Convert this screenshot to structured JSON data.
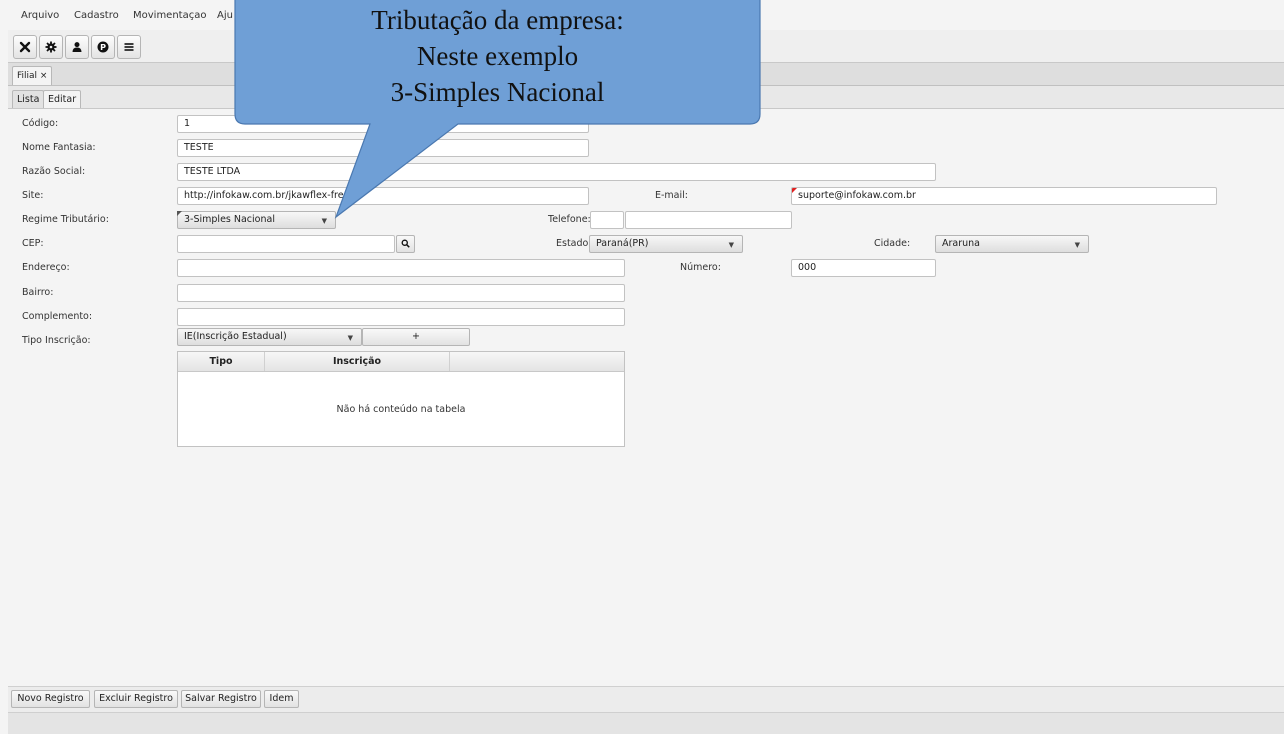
{
  "menu": [
    "Arquivo",
    "Cadastro",
    "Movimentaçao",
    "Aju"
  ],
  "toolbar": {
    "buttons": [
      "close-icon",
      "gear-icon",
      "user-icon",
      "p-circle-icon",
      "menu-icon"
    ]
  },
  "doc_tab": {
    "label": "Filial ×"
  },
  "sub_tabs": [
    "Lista",
    "Editar"
  ],
  "form": {
    "codigo": {
      "label": "Código:",
      "value": "1"
    },
    "nome_fantasia": {
      "label": "Nome Fantasia:",
      "value": "TESTE"
    },
    "razao_social": {
      "label": "Razão Social:",
      "value": "TESTE LTDA"
    },
    "site": {
      "label": "Site:",
      "value": "http://infokaw.com.br/jkawflex-fre"
    },
    "email": {
      "label": "E-mail:",
      "value": "suporte@infokaw.com.br"
    },
    "regime": {
      "label": "Regime Tributário:",
      "value": "3-Simples Nacional"
    },
    "telefone": {
      "label": "Telefone:",
      "ddd": "",
      "value": ""
    },
    "cep": {
      "label": "CEP:",
      "value": ""
    },
    "estado": {
      "label": "Estado:",
      "value": "Paraná(PR)"
    },
    "cidade": {
      "label": "Cidade:",
      "value": "Araruna"
    },
    "endereco": {
      "label": "Endereço:",
      "value": ""
    },
    "numero": {
      "label": "Número:",
      "value": "000"
    },
    "bairro": {
      "label": "Bairro:",
      "value": ""
    },
    "complemento": {
      "label": "Complemento:",
      "value": ""
    },
    "tipo_inscricao": {
      "label": "Tipo Inscrição:",
      "value": "IE(Inscrição Estadual)",
      "add_label": "+"
    }
  },
  "table": {
    "columns": [
      "Tipo",
      "Inscrição"
    ],
    "empty_message": "Não há conteúdo na tabela"
  },
  "bottom_buttons": [
    "Novo Registro",
    "Excluir Registro",
    "Salvar Registro",
    "Idem"
  ],
  "callout": {
    "lines": [
      "Tributação da empresa:",
      "Neste exemplo",
      "3-Simples Nacional"
    ],
    "fill": "#6f9fd6",
    "stroke": "#4a78b0"
  }
}
